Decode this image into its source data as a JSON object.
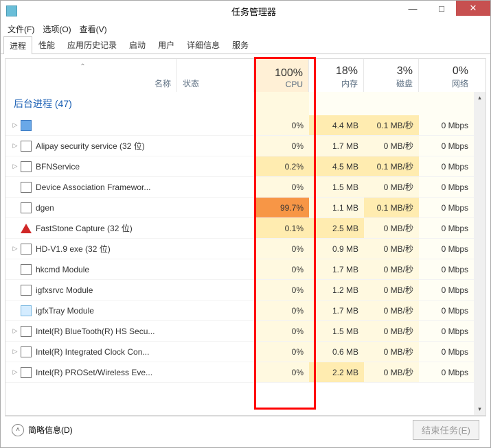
{
  "window": {
    "title": "任务管理器",
    "minimize": "—",
    "maximize": "□",
    "close": "✕"
  },
  "menu": {
    "file": "文件(F)",
    "options": "选项(O)",
    "view": "查看(V)"
  },
  "tabs": [
    "进程",
    "性能",
    "应用历史记录",
    "启动",
    "用户",
    "详细信息",
    "服务"
  ],
  "active_tab": 0,
  "columns": {
    "name": "名称",
    "status": "状态",
    "cpu_pct": "100%",
    "cpu_lbl": "CPU",
    "mem_pct": "18%",
    "mem_lbl": "内存",
    "disk_pct": "3%",
    "disk_lbl": "磁盘",
    "net_pct": "0%",
    "net_lbl": "网络"
  },
  "group": {
    "label": "后台进程 (47)"
  },
  "rows": [
    {
      "exp": true,
      "icon": "gear",
      "name": "",
      "cpu": "0%",
      "mem": "4.4 MB",
      "disk": "0.1 MB/秒",
      "net": "0 Mbps",
      "cpu_heat": "heat0",
      "mem_heat": "heat1",
      "disk_heat": "heat1"
    },
    {
      "exp": true,
      "icon": "app",
      "name": "Alipay security service (32 位)",
      "cpu": "0%",
      "mem": "1.7 MB",
      "disk": "0 MB/秒",
      "net": "0 Mbps",
      "cpu_heat": "heat0",
      "mem_heat": "heat0",
      "disk_heat": "heat0"
    },
    {
      "exp": true,
      "icon": "app",
      "name": "BFNService",
      "cpu": "0.2%",
      "mem": "4.5 MB",
      "disk": "0.1 MB/秒",
      "net": "0 Mbps",
      "cpu_heat": "heat1",
      "mem_heat": "heat1",
      "disk_heat": "heat1"
    },
    {
      "exp": false,
      "icon": "app",
      "name": "Device Association Framewor...",
      "cpu": "0%",
      "mem": "1.5 MB",
      "disk": "0 MB/秒",
      "net": "0 Mbps",
      "cpu_heat": "heat0",
      "mem_heat": "heat0",
      "disk_heat": "heat0"
    },
    {
      "exp": false,
      "icon": "app",
      "name": "dgen",
      "cpu": "99.7%",
      "mem": "1.1 MB",
      "disk": "0.1 MB/秒",
      "net": "0 Mbps",
      "cpu_heat": "heat-hot",
      "mem_heat": "heat0",
      "disk_heat": "heat1"
    },
    {
      "exp": false,
      "icon": "fs",
      "name": "FastStone Capture (32 位)",
      "cpu": "0.1%",
      "mem": "2.5 MB",
      "disk": "0 MB/秒",
      "net": "0 Mbps",
      "cpu_heat": "heat1",
      "mem_heat": "heat1",
      "disk_heat": "heat0"
    },
    {
      "exp": true,
      "icon": "app",
      "name": "HD-V1.9 exe (32 位)",
      "cpu": "0%",
      "mem": "0.9 MB",
      "disk": "0 MB/秒",
      "net": "0 Mbps",
      "cpu_heat": "heat0",
      "mem_heat": "heat0",
      "disk_heat": "heat0"
    },
    {
      "exp": false,
      "icon": "app",
      "name": "hkcmd Module",
      "cpu": "0%",
      "mem": "1.7 MB",
      "disk": "0 MB/秒",
      "net": "0 Mbps",
      "cpu_heat": "heat0",
      "mem_heat": "heat0",
      "disk_heat": "heat0"
    },
    {
      "exp": false,
      "icon": "app",
      "name": "igfxsrvc Module",
      "cpu": "0%",
      "mem": "1.2 MB",
      "disk": "0 MB/秒",
      "net": "0 Mbps",
      "cpu_heat": "heat0",
      "mem_heat": "heat0",
      "disk_heat": "heat0"
    },
    {
      "exp": false,
      "icon": "tray",
      "name": "igfxTray Module",
      "cpu": "0%",
      "mem": "1.7 MB",
      "disk": "0 MB/秒",
      "net": "0 Mbps",
      "cpu_heat": "heat0",
      "mem_heat": "heat0",
      "disk_heat": "heat0"
    },
    {
      "exp": true,
      "icon": "app",
      "name": "Intel(R) BlueTooth(R) HS Secu...",
      "cpu": "0%",
      "mem": "1.5 MB",
      "disk": "0 MB/秒",
      "net": "0 Mbps",
      "cpu_heat": "heat0",
      "mem_heat": "heat0",
      "disk_heat": "heat0"
    },
    {
      "exp": true,
      "icon": "app",
      "name": "Intel(R) Integrated Clock Con...",
      "cpu": "0%",
      "mem": "0.6 MB",
      "disk": "0 MB/秒",
      "net": "0 Mbps",
      "cpu_heat": "heat0",
      "mem_heat": "heat0",
      "disk_heat": "heat0"
    },
    {
      "exp": true,
      "icon": "app",
      "name": "Intel(R) PROSet/Wireless Eve...",
      "cpu": "0%",
      "mem": "2.2 MB",
      "disk": "0 MB/秒",
      "net": "0 Mbps",
      "cpu_heat": "heat0",
      "mem_heat": "heat1",
      "disk_heat": "heat0"
    }
  ],
  "footer": {
    "fewer": "简略信息(D)",
    "end_task": "结束任务(E)"
  }
}
